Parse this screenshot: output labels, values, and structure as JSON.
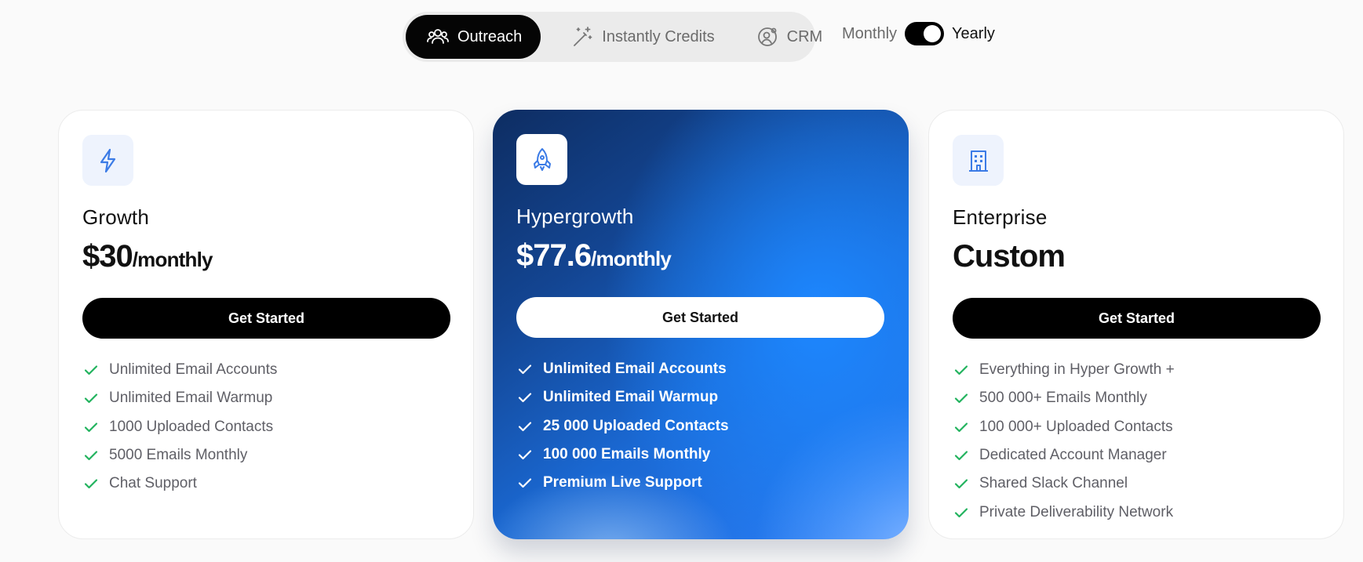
{
  "tabs": [
    {
      "label": "Outreach",
      "icon": "users-icon",
      "active": true
    },
    {
      "label": "Instantly Credits",
      "icon": "magic-wand-icon",
      "active": false
    },
    {
      "label": "CRM",
      "icon": "user-gear-icon",
      "active": false
    }
  ],
  "billing": {
    "monthly_label": "Monthly",
    "yearly_label": "Yearly",
    "selected": "Yearly"
  },
  "colors": {
    "accent_blue": "#1d87ff",
    "check_green": "#22b35e",
    "icon_blue": "#3b7be6"
  },
  "plans": [
    {
      "icon": "lightning-icon",
      "name": "Growth",
      "price": "$30",
      "period": "/monthly",
      "cta": "Get Started",
      "features": [
        "Unlimited Email Accounts",
        "Unlimited Email Warmup",
        "1000 Uploaded Contacts",
        "5000 Emails Monthly",
        "Chat Support"
      ]
    },
    {
      "icon": "rocket-icon",
      "name": "Hypergrowth",
      "price": "$77.6",
      "period": "/monthly",
      "cta": "Get Started",
      "features": [
        "Unlimited Email Accounts",
        "Unlimited Email Warmup",
        "25 000 Uploaded Contacts",
        "100 000 Emails Monthly",
        "Premium Live Support"
      ]
    },
    {
      "icon": "building-icon",
      "name": "Enterprise",
      "price": "Custom",
      "period": "",
      "cta": "Get Started",
      "features": [
        "Everything in Hyper Growth +",
        "500 000+ Emails Monthly",
        "100 000+ Uploaded Contacts",
        "Dedicated Account Manager",
        "Shared Slack Channel",
        "Private Deliverability Network"
      ]
    }
  ]
}
